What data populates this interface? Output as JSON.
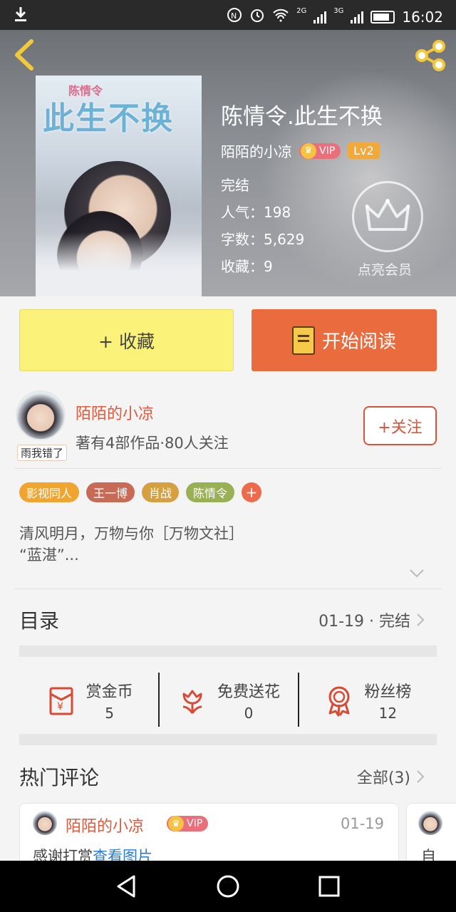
{
  "status_bar": {
    "time": "16:02",
    "net1": "2G",
    "net2": "3G",
    "icons": [
      "download-icon",
      "nfc-icon",
      "alarm-icon",
      "wifi-icon",
      "signal-icon",
      "battery-icon"
    ]
  },
  "header": {
    "back_icon": "chevron-left-icon",
    "share_icon": "share-icon"
  },
  "book": {
    "cover_title": "此生不换",
    "cover_subtitle": "陈情令",
    "title": "陈情令.此生不换",
    "author": "陌陌的小凉",
    "vip": "VIP",
    "level": "Lv2",
    "status": "完结",
    "popularity": "人气：198",
    "word_count": "字数：5,629",
    "favorites": "收藏：9",
    "member_label": "点亮会员"
  },
  "actions": {
    "collect": "+ 收藏",
    "read": "开始阅读"
  },
  "author_section": {
    "name": "陌陌的小凉",
    "info": "著有4部作品·80人关注",
    "avatar_tag": "雨我错了",
    "follow": "+关注"
  },
  "tags": [
    {
      "label": "影视同人",
      "color": "#f0a531"
    },
    {
      "label": "王一博",
      "color": "#c76b57"
    },
    {
      "label": "肖战",
      "color": "#d4a042"
    },
    {
      "label": "陈情令",
      "color": "#9ab054"
    }
  ],
  "tag_add": "+",
  "description": {
    "line1": "清风明月，万物与你［万物文社］",
    "line2": "“蓝湛”..."
  },
  "catalog": {
    "label": "目录",
    "info": "01-19 · 完结"
  },
  "rewards": [
    {
      "name": "赏金币",
      "value": "5",
      "icon": "red-envelope-icon"
    },
    {
      "name": "免费送花",
      "value": "0",
      "icon": "flower-icon"
    },
    {
      "name": "粉丝榜",
      "value": "12",
      "icon": "medal-icon"
    }
  ],
  "comments_section": {
    "label": "热门评论",
    "all": "全部(3)"
  },
  "comment": {
    "name": "陌陌的小凉",
    "vip": "VIP",
    "date": "01-19",
    "text": "感谢打赏",
    "link": "查看图片"
  },
  "comment2_text": "自",
  "colors": {
    "accent_orange": "#ea6b3e",
    "collect_yellow": "#fbf27a",
    "author_red": "#dd5a3d"
  }
}
